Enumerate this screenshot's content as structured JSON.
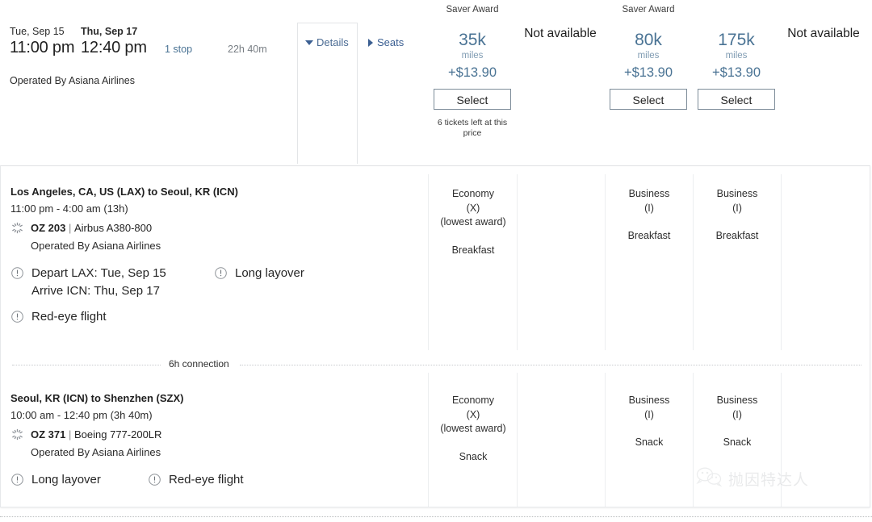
{
  "summary": {
    "depart_date": "Tue, Sep 15",
    "arrive_date": "Thu, Sep 17",
    "depart_time": "11:00 pm",
    "arrive_time": "12:40 pm",
    "stops": "1 stop",
    "duration": "22h 40m",
    "operated_by": "Operated By Asiana Airlines",
    "details_label": "Details",
    "seats_label": "Seats"
  },
  "fares": [
    {
      "header": "Saver Award",
      "miles": "35k",
      "miles_unit": "miles",
      "price": "+$13.90",
      "select_label": "Select",
      "note": "6 tickets left at this price",
      "available": true
    },
    {
      "header": "",
      "not_available_label": "Not available",
      "available": false
    },
    {
      "header": "Saver Award",
      "miles": "80k",
      "miles_unit": "miles",
      "price": "+$13.90",
      "select_label": "Select",
      "note": "",
      "available": true
    },
    {
      "header": "",
      "miles": "175k",
      "miles_unit": "miles",
      "price": "+$13.90",
      "select_label": "Select",
      "note": "",
      "available": true
    },
    {
      "header": "",
      "not_available_label": "Not available",
      "available": false
    }
  ],
  "segments": [
    {
      "route": "Los Angeles, CA, US (LAX) to Seoul, KR (ICN)",
      "times": "11:00 pm - 4:00 am (13h)",
      "flight_number": "OZ 203",
      "separator": "|",
      "aircraft": "Airbus A380-800",
      "operated_by": "Operated By Asiana Airlines",
      "alerts_primary": [
        "Depart LAX: Tue, Sep 15",
        "Arrive ICN: Thu, Sep 17"
      ],
      "alert_secondary": "Long layover",
      "alert_third": "Red-eye flight",
      "cabins": [
        {
          "name": "Economy",
          "code": "(X)",
          "note": "(lowest award)",
          "meal": "Breakfast"
        },
        {
          "name": "",
          "code": "",
          "note": "",
          "meal": ""
        },
        {
          "name": "Business",
          "code": "(I)",
          "note": "",
          "meal": "Breakfast"
        },
        {
          "name": "Business",
          "code": "(I)",
          "note": "",
          "meal": "Breakfast"
        },
        {
          "name": "",
          "code": "",
          "note": "",
          "meal": ""
        }
      ]
    },
    {
      "route": "Seoul, KR (ICN) to Shenzhen (SZX)",
      "times": "10:00 am - 12:40 pm (3h 40m)",
      "flight_number": "OZ 371",
      "separator": "|",
      "aircraft": "Boeing 777-200LR",
      "operated_by": "Operated By Asiana Airlines",
      "alert_one": "Long layover",
      "alert_two": "Red-eye flight",
      "cabins": [
        {
          "name": "Economy",
          "code": "(X)",
          "note": "(lowest award)",
          "meal": "Snack"
        },
        {
          "name": "",
          "code": "",
          "note": "",
          "meal": ""
        },
        {
          "name": "Business",
          "code": "(I)",
          "note": "",
          "meal": "Snack"
        },
        {
          "name": "Business",
          "code": "(I)",
          "note": "",
          "meal": "Snack"
        },
        {
          "name": "",
          "code": "",
          "note": "",
          "meal": ""
        }
      ]
    }
  ],
  "connection": {
    "label": "6h connection"
  },
  "watermark": {
    "text": "抛因特达人"
  },
  "colors": {
    "link_blue": "#4a7394",
    "accent_blue": "#3b5f92",
    "border_gray": "#e6e8ea",
    "muted_gray": "#777d83"
  }
}
